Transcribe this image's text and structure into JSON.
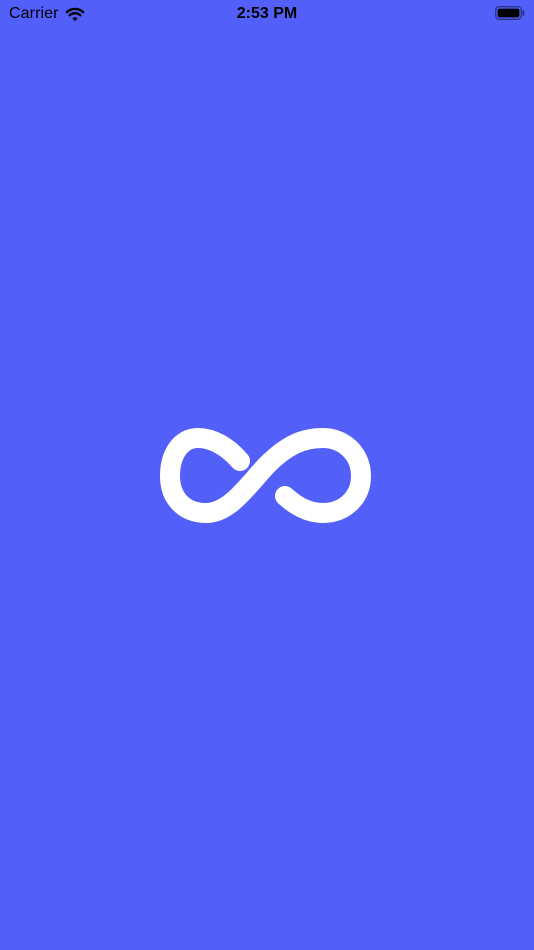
{
  "status_bar": {
    "carrier": "Carrier",
    "time": "2:53 PM",
    "wifi_icon": "wifi-icon",
    "battery_icon": "battery-icon"
  },
  "main": {
    "logo_icon": "infinity-icon"
  },
  "colors": {
    "background": "#525FF8",
    "logo": "#FFFFFF",
    "status_text": "#000000"
  }
}
